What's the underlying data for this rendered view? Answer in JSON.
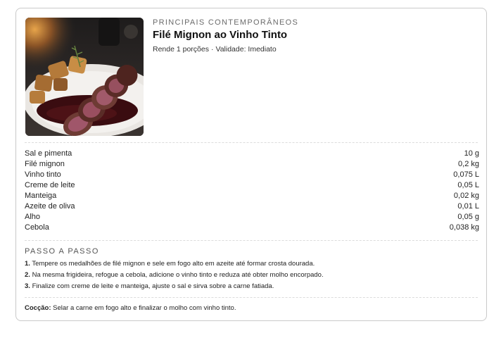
{
  "recipe": {
    "category": "PRINCIPAIS CONTEMPORÂNEOS",
    "title": "Filé Mignon ao Vinho Tinto",
    "yield": "Rende 1 porções",
    "separator": "·",
    "validity": "Validade: Imediato"
  },
  "ingredients": [
    {
      "name": "Sal e pimenta",
      "qty": "10 g"
    },
    {
      "name": "Filé mignon",
      "qty": "0,2 kg"
    },
    {
      "name": "Vinho tinto",
      "qty": "0,075 L"
    },
    {
      "name": "Creme de leite",
      "qty": "0,05 L"
    },
    {
      "name": "Manteiga",
      "qty": "0,02 kg"
    },
    {
      "name": "Azeite de oliva",
      "qty": "0,01 L"
    },
    {
      "name": "Alho",
      "qty": "0,05 g"
    },
    {
      "name": "Cebola",
      "qty": "0,038 kg"
    }
  ],
  "steps_title": "PASSO A PASSO",
  "steps": [
    {
      "num": "1.",
      "text": "Tempere os medalhões de filé mignon e sele em fogo alto em azeite até formar crosta dourada."
    },
    {
      "num": "2.",
      "text": "Na mesma frigideira, refogue a cebola, adicione o vinho tinto e reduza até obter molho encorpado."
    },
    {
      "num": "3.",
      "text": "Finalize com creme de leite e manteiga, ajuste o sal e sirva sobre a carne fatiada."
    }
  ],
  "cooking": {
    "label": "Cocção:",
    "text": "Selar a carne em fogo alto e finalizar o molho com vinho tinto."
  },
  "colors": {
    "border": "#c9c9c9",
    "muted": "#6b6b6b",
    "sauce": "#3a0c10",
    "meat": "#6e3b34"
  }
}
